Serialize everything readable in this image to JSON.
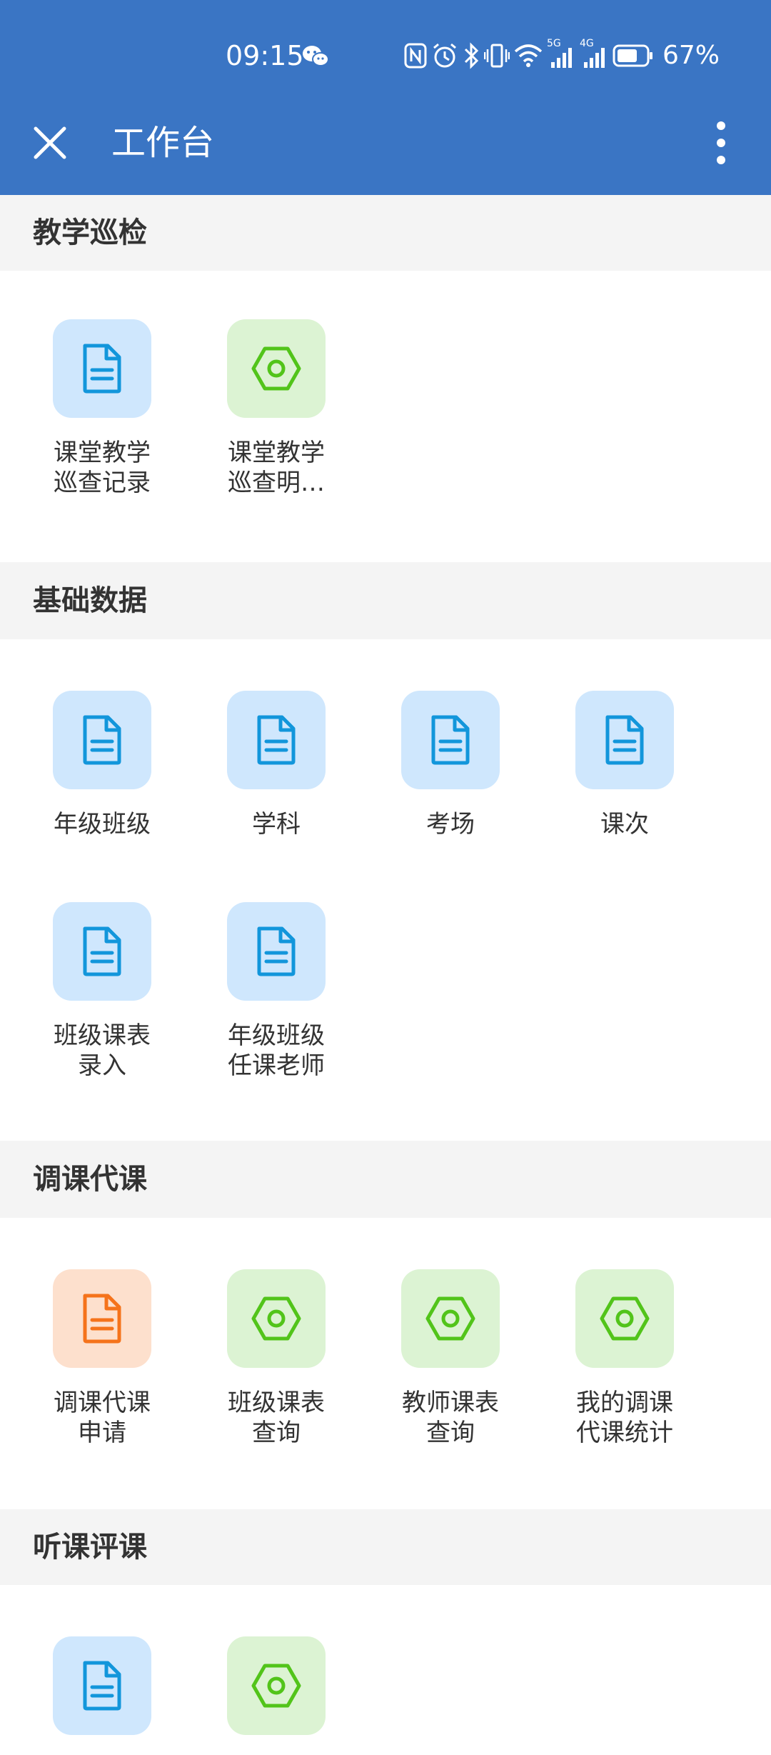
{
  "status_bar": {
    "time": "09:15",
    "battery": "67%",
    "net_5g": "5G",
    "net_4g": "4G"
  },
  "header": {
    "title": "工作台"
  },
  "sections": [
    {
      "title": "教学巡检",
      "items": [
        {
          "label": "课堂教学\n巡查记录",
          "icon": "document-icon",
          "color": "blue"
        },
        {
          "label": "课堂教学\n巡查明…",
          "icon": "hexagon-icon",
          "color": "green"
        }
      ]
    },
    {
      "title": "基础数据",
      "items": [
        {
          "label": "年级班级",
          "icon": "document-icon",
          "color": "blue"
        },
        {
          "label": "学科",
          "icon": "document-icon",
          "color": "blue"
        },
        {
          "label": "考场",
          "icon": "document-icon",
          "color": "blue"
        },
        {
          "label": "课次",
          "icon": "document-icon",
          "color": "blue"
        },
        {
          "label": "班级课表\n录入",
          "icon": "document-icon",
          "color": "blue"
        },
        {
          "label": "年级班级\n任课老师",
          "icon": "document-icon",
          "color": "blue"
        }
      ]
    },
    {
      "title": "调课代课",
      "items": [
        {
          "label": "调课代课\n申请",
          "icon": "document-icon",
          "color": "orange"
        },
        {
          "label": "班级课表\n查询",
          "icon": "hexagon-icon",
          "color": "green"
        },
        {
          "label": "教师课表\n查询",
          "icon": "hexagon-icon",
          "color": "green"
        },
        {
          "label": "我的调课\n代课统计",
          "icon": "hexagon-icon",
          "color": "green"
        }
      ]
    },
    {
      "title": "听课评课",
      "items": [
        {
          "label": "",
          "icon": "document-icon",
          "color": "blue"
        },
        {
          "label": "",
          "icon": "hexagon-icon",
          "color": "green"
        }
      ]
    }
  ],
  "colors": {
    "header": "#3a75c4",
    "blue_icon": "#1296db",
    "green_icon": "#52c41a",
    "orange_icon": "#f5731b"
  }
}
